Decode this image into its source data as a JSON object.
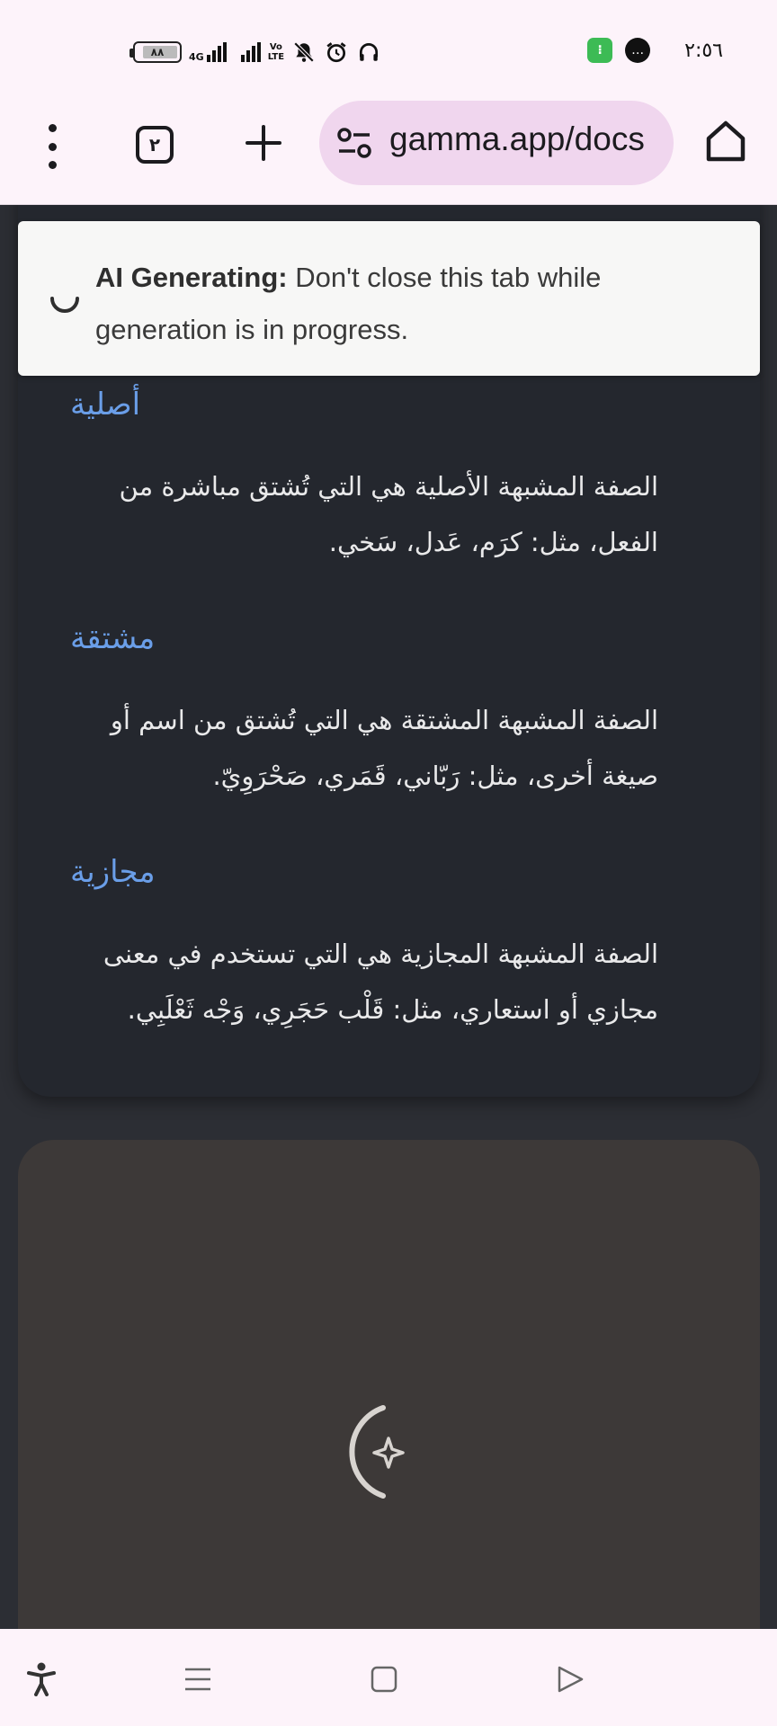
{
  "status_bar": {
    "battery_level": "٨٨",
    "network_type": "4G",
    "volte_label": "VoLTE 2",
    "time": "٢:٥٦",
    "icons": [
      "battery-icon",
      "signal-icon",
      "signal-icon",
      "volte-icon",
      "mute-icon",
      "alarm-icon",
      "headphones-icon",
      "app-notification-icon",
      "message-notification-icon"
    ]
  },
  "browser": {
    "tab_count": "٢",
    "url": "gamma.app/docs",
    "icons": [
      "more-vert-icon",
      "tabs-icon",
      "new-tab-icon",
      "site-settings-icon",
      "home-icon"
    ]
  },
  "banner": {
    "bold": "AI Generating:",
    "text": " Don't close this tab while generation is in progress."
  },
  "sections": [
    {
      "title": "أصلية",
      "body": "الصفة المشبهة الأصلية هي التي تُشتق مباشرة من الفعل، مثل: كرَم، عَدل، سَخي."
    },
    {
      "title": "مشتقة",
      "body": "الصفة المشبهة المشتقة هي التي تُشتق من اسم أو صيغة أخرى، مثل: رَبّاني، قَمَري، صَحْرَوِيّ."
    },
    {
      "title": "مجازية",
      "body": "الصفة المشبهة المجازية هي التي تستخدم في معنى مجازي أو استعاري، مثل: قَلْب حَجَرِي، وَجْه ثَعْلَبِي."
    }
  ],
  "colors": {
    "accent_heading": "#6a9ee8",
    "card_bg": "#24272e",
    "placeholder_card_bg": "#3d3938",
    "browser_chrome": "#fdf3fa",
    "url_pill": "#f0d6ee"
  },
  "nav_bar": {
    "icons": [
      "accessibility-icon",
      "recents-icon",
      "home-nav-icon",
      "back-icon"
    ]
  }
}
